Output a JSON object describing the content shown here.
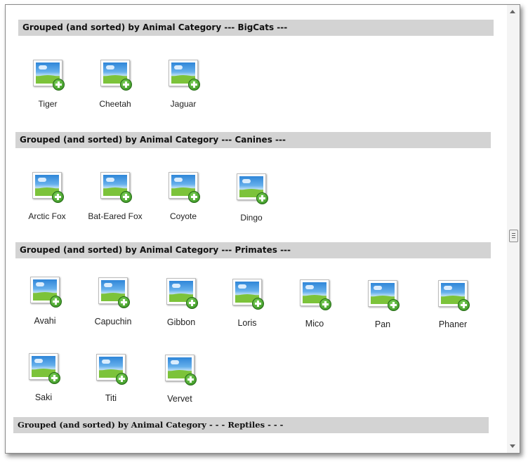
{
  "groups": {
    "bigcats": {
      "header": "Grouped (and sorted) by Animal Category --- BigCats ---",
      "items": [
        "Tiger",
        "Cheetah",
        "Jaguar"
      ]
    },
    "canines": {
      "header": "Grouped (and sorted) by Animal Category --- Canines ---",
      "items": [
        "Arctic Fox",
        "Bat-Eared Fox",
        "Coyote",
        "Dingo"
      ]
    },
    "primates": {
      "header": "Grouped (and sorted) by Animal Category --- Primates ---",
      "items": [
        "Avahi",
        "Capuchin",
        "Gibbon",
        "Loris",
        "Mico",
        "Pan",
        "Phaner",
        "Saki",
        "Titi",
        "Vervet"
      ]
    },
    "reptiles": {
      "header": "Grouped (and sorted) by Animal Category - - - Reptiles - - -"
    }
  },
  "icons": {
    "item": "image-add-icon"
  }
}
